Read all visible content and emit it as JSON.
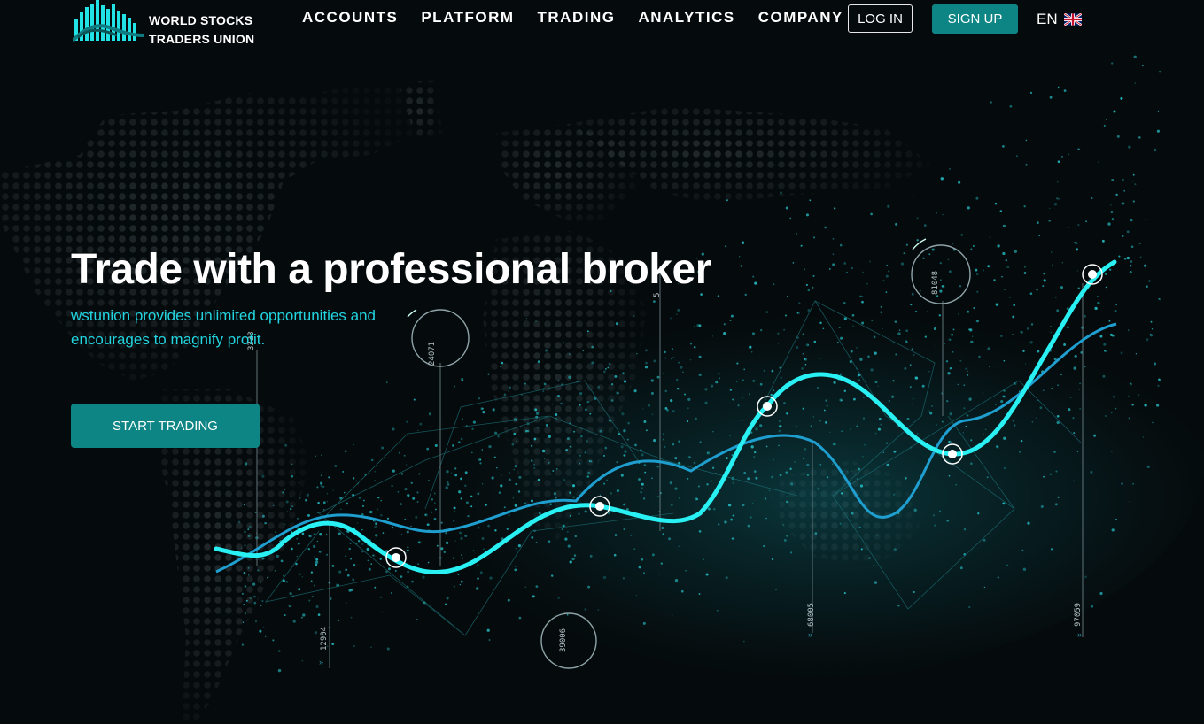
{
  "brand": {
    "name_line1": "WORLD STOCKS",
    "name_line2": "TRADERS UNION",
    "logo_icon": "bar-chart-logo-icon"
  },
  "nav": {
    "items": [
      {
        "label": "ACCOUNTS"
      },
      {
        "label": "PLATFORM"
      },
      {
        "label": "TRADING"
      },
      {
        "label": "ANALYTICS"
      },
      {
        "label": "COMPANY"
      }
    ]
  },
  "auth": {
    "login_label": "LOG IN",
    "signup_label": "SIGN UP"
  },
  "language": {
    "current": "EN",
    "flag_icon": "uk-flag-icon"
  },
  "hero": {
    "title": "Trade with a professional broker",
    "subtitle": "wstunion provides unlimited opportunities and encourages to magnify profit.",
    "cta_label": "START TRADING"
  },
  "graphic": {
    "axis_labels": [
      "12904",
      "39006",
      "68005",
      "97059",
      "24071",
      "3333",
      "81048",
      "5"
    ]
  },
  "colors": {
    "background": "#050a0c",
    "accent": "#0e8585",
    "highlight": "#22d5e0",
    "line_primary": "#29f0f3",
    "line_secondary": "#1f9fcf"
  }
}
